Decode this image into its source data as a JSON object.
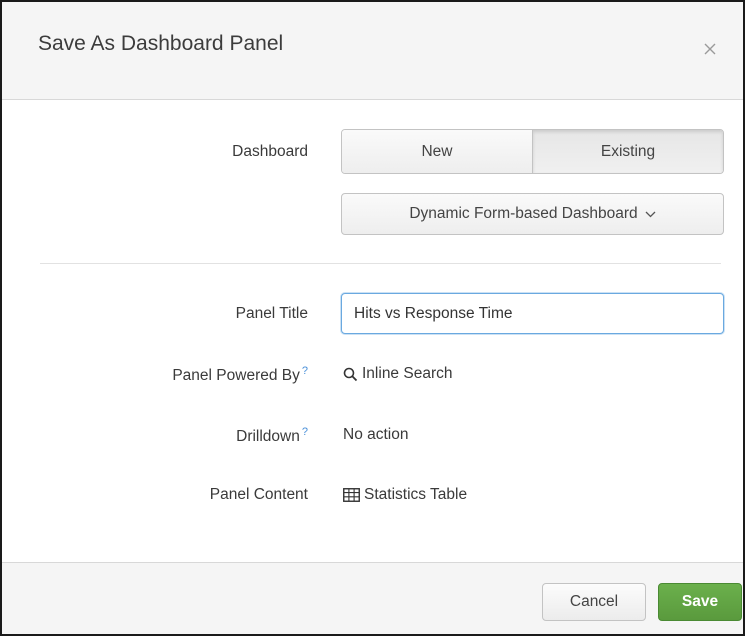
{
  "dialog": {
    "title": "Save As Dashboard Panel",
    "close_icon": "close-icon"
  },
  "form": {
    "dashboard": {
      "label": "Dashboard",
      "options": [
        "New",
        "Existing"
      ],
      "selected": "Existing",
      "select_value": "Dynamic Form-based Dashboard",
      "select_icon": "chevron-down-icon"
    },
    "panel_title": {
      "label": "Panel Title",
      "value": "Hits vs Response Time"
    },
    "powered_by": {
      "label": "Panel Powered By",
      "help": "?",
      "icon": "search-icon",
      "value": "Inline Search"
    },
    "drilldown": {
      "label": "Drilldown",
      "help": "?",
      "value": "No action"
    },
    "panel_content": {
      "label": "Panel Content",
      "icon": "table-icon",
      "value": "Statistics Table"
    }
  },
  "footer": {
    "cancel_label": "Cancel",
    "save_label": "Save"
  },
  "colors": {
    "save_button": "#5fa243",
    "focus_border": "#6aa9e0",
    "help_mark": "#4a90d9"
  }
}
